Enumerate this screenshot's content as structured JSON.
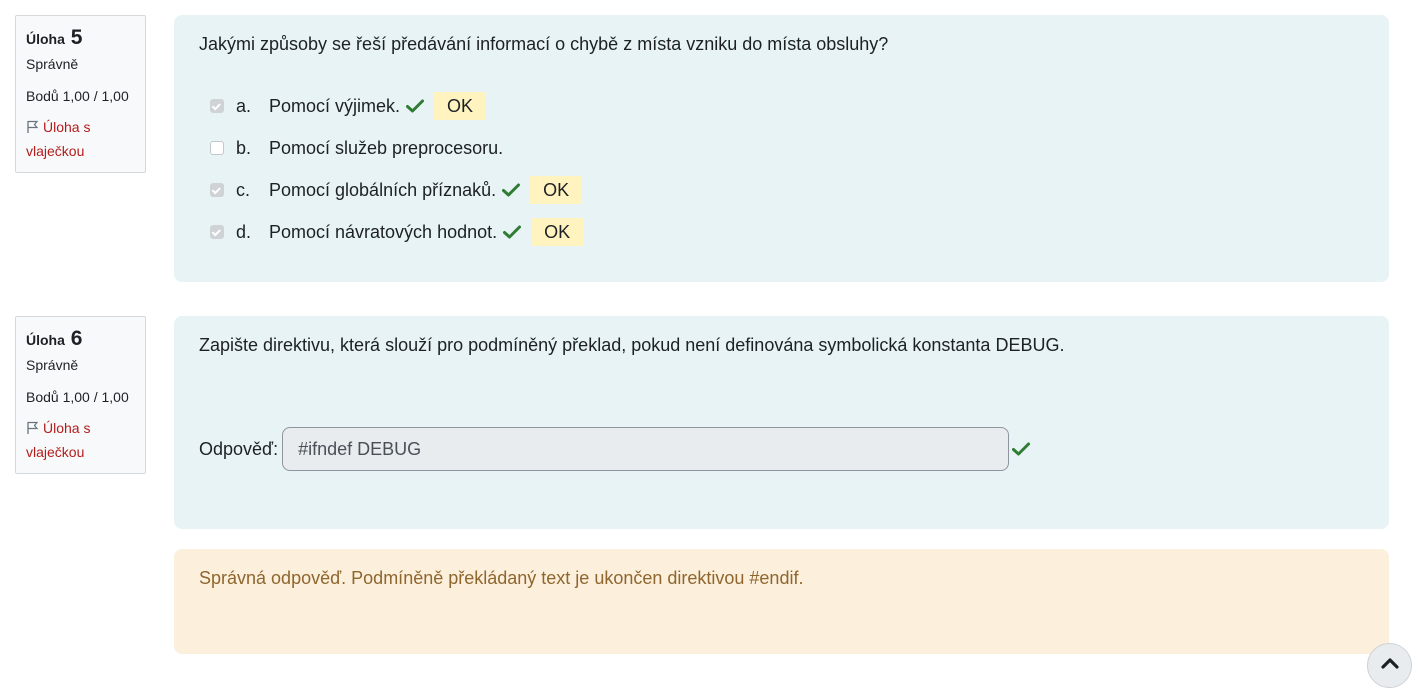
{
  "questions": [
    {
      "label": "Úloha",
      "number": "5",
      "state": "Správně",
      "grade": "Bodů 1,00 / 1,00",
      "flag_text": "Úloha s vlaječkou",
      "text": "Jakými způsoby se řeší předávání informací o chybě z místa vzniku do místa obsluhy?",
      "answers": [
        {
          "letter": "a.",
          "text": "Pomocí výjimek.",
          "checked": true,
          "correct": true,
          "badge": "OK"
        },
        {
          "letter": "b.",
          "text": "Pomocí služeb preprocesoru.",
          "checked": false,
          "correct": false,
          "badge": ""
        },
        {
          "letter": "c.",
          "text": "Pomocí globálních příznaků.",
          "checked": true,
          "correct": true,
          "badge": "OK"
        },
        {
          "letter": "d.",
          "text": "Pomocí návratových hodnot.",
          "checked": true,
          "correct": true,
          "badge": "OK"
        }
      ]
    },
    {
      "label": "Úloha",
      "number": "6",
      "state": "Správně",
      "grade": "Bodů 1,00 / 1,00",
      "flag_text": "Úloha s vlaječkou",
      "text": "Zapište direktivu, která slouží pro podmíněný překlad, pokud není definována symbolická konstanta DEBUG.",
      "answer_label": "Odpověď:",
      "answer_value": "#ifndef DEBUG",
      "feedback": "Správná odpověď. Podmíněně překládaný text je ukončen direktivou #endif."
    }
  ],
  "colors": {
    "correct_tick": "#2e7d32",
    "flag": "#b31c1c",
    "content_bg": "#e7f3f5",
    "feedback_bg": "#fcefdc",
    "ok_badge_bg": "#fff3bf"
  },
  "icons": {
    "flag": "flag-icon",
    "tick": "check-icon",
    "scroll_top": "chevron-up-icon"
  }
}
